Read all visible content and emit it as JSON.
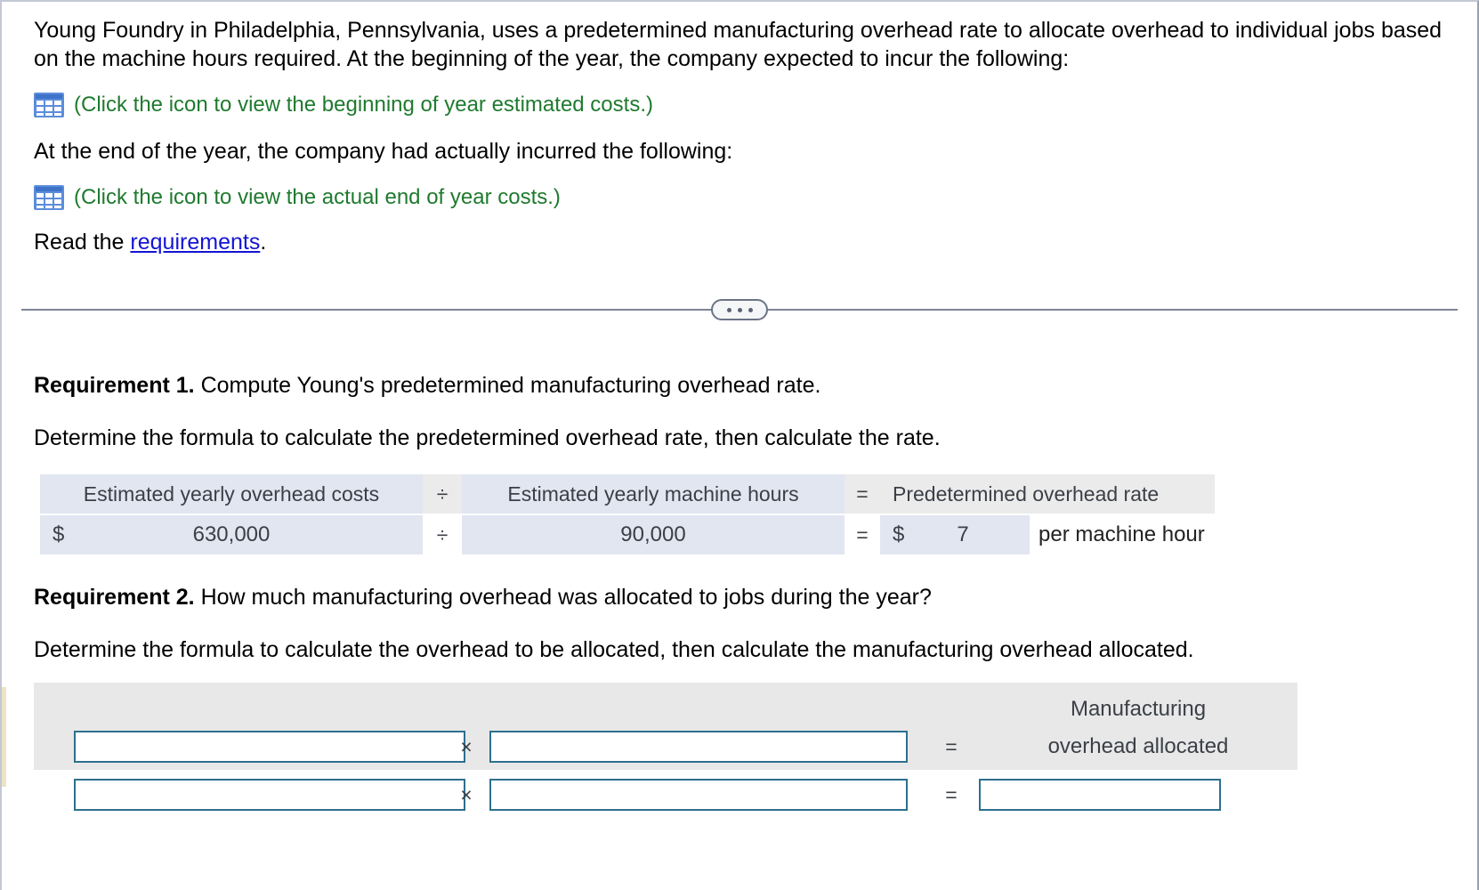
{
  "problem": {
    "intro": "Young Foundry in Philadelphia, Pennsylvania, uses a predetermined manufacturing overhead rate to allocate overhead to individual jobs based on the machine hours required. At the beginning of the year, the company expected to incur the following:",
    "estimated_costs_link": "(Click the icon to view the beginning of year estimated costs.)",
    "mid_text": "At the end of the year, the company had actually incurred the following:",
    "actual_costs_link": "(Click the icon to view the actual end of year costs.)",
    "read_prefix": "Read the ",
    "read_link": "requirements",
    "read_suffix": "."
  },
  "colors": {
    "link_green": "#1f7a2e",
    "link_blue": "#1414d4",
    "icon_blue": "#4a7fd4",
    "header_blue_gray": "#e1e6f1",
    "header_gray": "#ebebeb",
    "input_border": "#2e6f8f",
    "req2_panel_gray": "#e8e8e8"
  },
  "divider": {
    "dots": "•••"
  },
  "requirement1": {
    "label": "Requirement 1.",
    "question": "Compute Young's predetermined manufacturing overhead rate.",
    "instruction": "Determine the formula to calculate the predetermined overhead rate, then calculate the rate.",
    "headers": {
      "numerator": "Estimated yearly overhead costs",
      "op1": "÷",
      "denominator": "Estimated yearly machine hours",
      "op2": "=",
      "result": "Predetermined overhead rate"
    },
    "values": {
      "numerator_currency": "$",
      "numerator": "630,000",
      "op1": "÷",
      "denominator": "90,000",
      "op2": "=",
      "result_currency": "$",
      "result": "7",
      "result_unit": "per machine hour"
    }
  },
  "requirement2": {
    "label": "Requirement 2.",
    "question": "How much manufacturing overhead was allocated to jobs during the year?",
    "instruction": "Determine the formula to calculate the overhead to be allocated, then calculate the manufacturing overhead allocated.",
    "result_label_line1": "Manufacturing",
    "result_label_line2": "overhead allocated",
    "op_multiply": "×",
    "op_equals": "=",
    "inputs": {
      "formula_left": "",
      "formula_right": "",
      "value_left": "",
      "value_right": "",
      "answer": ""
    }
  },
  "chart_data": {
    "type": "table",
    "title": "Predetermined overhead rate computation",
    "columns": [
      "Estimated yearly overhead costs",
      "÷",
      "Estimated yearly machine hours",
      "=",
      "Predetermined overhead rate"
    ],
    "rows": [
      [
        "$ 630,000",
        "÷",
        "90,000",
        "=",
        "$ 7 per machine hour"
      ]
    ]
  }
}
